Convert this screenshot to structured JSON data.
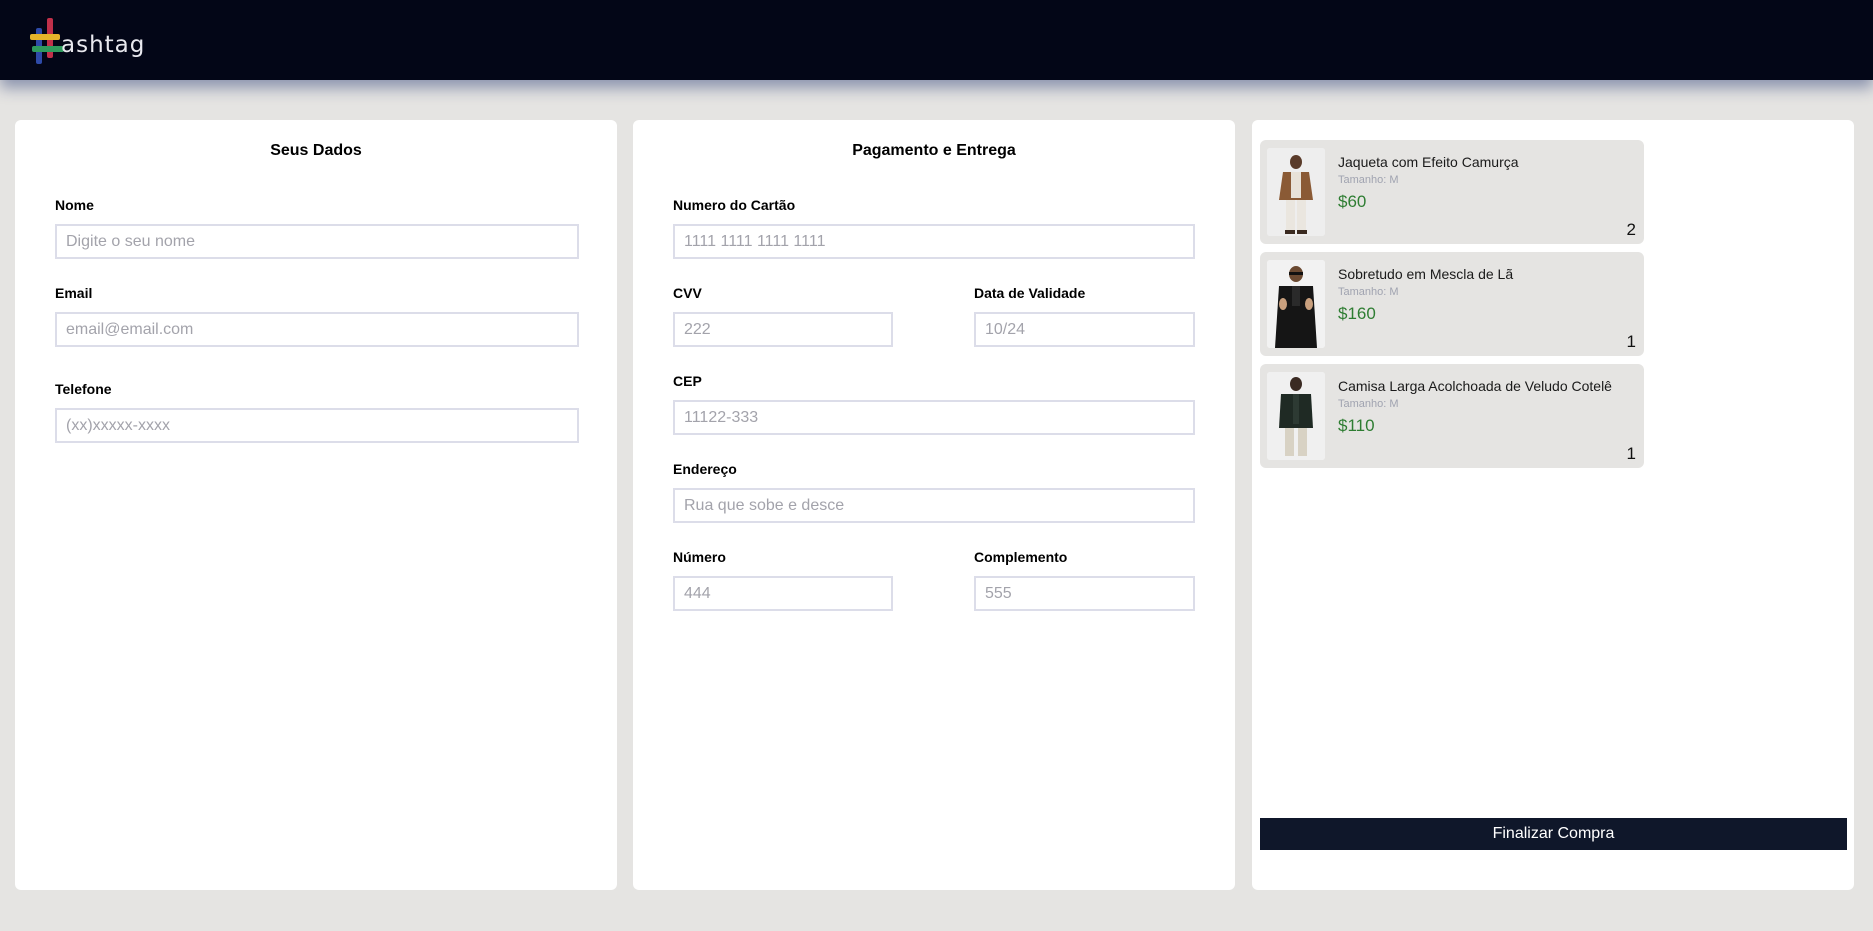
{
  "brand": {
    "logo_text": "ashtag",
    "logo_icon": "hashtag-logo-icon"
  },
  "seus_dados": {
    "title": "Seus Dados",
    "fields": [
      {
        "label": "Nome",
        "placeholder": "Digite o seu nome"
      },
      {
        "label": "Email",
        "placeholder": "email@email.com"
      },
      {
        "label": "Telefone",
        "placeholder": "(xx)xxxxx-xxxx"
      }
    ]
  },
  "pagamento": {
    "title": "Pagamento e Entrega",
    "card_number": {
      "label": "Numero do Cartão",
      "placeholder": "1111 1111 1111 1111"
    },
    "cvv": {
      "label": "CVV",
      "placeholder": "222"
    },
    "validade": {
      "label": "Data de Validade",
      "placeholder": "10/24"
    },
    "cep": {
      "label": "CEP",
      "placeholder": "11122-333"
    },
    "endereco": {
      "label": "Endereço",
      "placeholder": "Rua que sobe e desce"
    },
    "numero": {
      "label": "Número",
      "placeholder": "444"
    },
    "complemento": {
      "label": "Complemento",
      "placeholder": "555"
    }
  },
  "cart": {
    "items": [
      {
        "name": "Jaqueta com Efeito Camurça",
        "size": "Tamanho: M",
        "price": "$60",
        "qty": "2",
        "image": "jacket-brown-photo"
      },
      {
        "name": "Sobretudo em Mescla de Lã",
        "size": "Tamanho: M",
        "price": "$160",
        "qty": "1",
        "image": "coat-black-photo"
      },
      {
        "name": "Camisa Larga Acolchoada de Veludo Cotelê",
        "size": "Tamanho: M",
        "price": "$110",
        "qty": "1",
        "image": "shirt-dark-photo"
      }
    ],
    "checkout_label": "Finalizar Compra"
  },
  "colors": {
    "header_bg": "#030617",
    "page_bg": "#e5e4e2",
    "price": "#2e7d32",
    "button_bg": "#0f172a"
  }
}
